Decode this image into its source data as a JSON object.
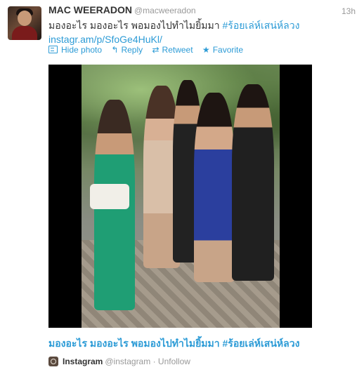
{
  "tweet": {
    "name": "MAC WEERADON",
    "handle": "@macweeradon",
    "time": "13h",
    "text_line1": "มองอะไร มองอะไร พอมองไปทำไมยิ้มมา",
    "hashtag": "#ร้อยเล่ห์เสน่ห์ลวง",
    "link": "instagr.am/p/SfoGe4HuKl/"
  },
  "actions": {
    "hide_photo": "Hide photo",
    "reply": "Reply",
    "retweet": "Retweet",
    "favorite": "Favorite"
  },
  "icons": {
    "photo": "photo-icon",
    "reply": "reply-arrow-icon",
    "retweet": "retweet-icon",
    "favorite": "star-icon",
    "instagram": "instagram-icon"
  },
  "media": {
    "caption": "มองอะไร มองอะไร พอมองไปทำไมยิ้มมา #ร้อยเล่ห์เสน่ห์ลวง"
  },
  "source": {
    "name": "Instagram",
    "handle": "@instagram",
    "separator": "·",
    "action": "Unfollow"
  },
  "colors": {
    "link": "#2c9bd6",
    "text": "#333333",
    "muted": "#999999"
  }
}
